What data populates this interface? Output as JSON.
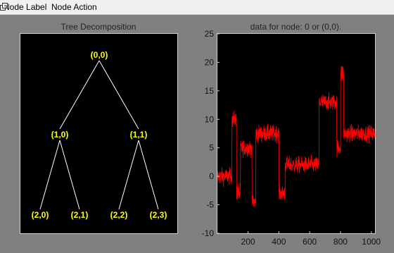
{
  "menu": {
    "items": [
      "Node Label",
      "Node Action"
    ]
  },
  "window_controls": {
    "undock_icon": "undock-icon"
  },
  "tree_panel": {
    "title": "Tree Decomposition",
    "nodes": [
      {
        "id": "0-0",
        "label": "(0,0)"
      },
      {
        "id": "1-0",
        "label": "(1,0)"
      },
      {
        "id": "1-1",
        "label": "(1,1)"
      },
      {
        "id": "2-0",
        "label": "(2,0)"
      },
      {
        "id": "2-1",
        "label": "(2,1)"
      },
      {
        "id": "2-2",
        "label": "(2,2)"
      },
      {
        "id": "2-3",
        "label": "(2,3)"
      }
    ],
    "edges": [
      [
        "0-0",
        "1-0"
      ],
      [
        "0-0",
        "1-1"
      ],
      [
        "1-0",
        "2-0"
      ],
      [
        "1-0",
        "2-1"
      ],
      [
        "1-1",
        "2-2"
      ],
      [
        "1-1",
        "2-3"
      ]
    ],
    "edge_color": "#ffffff",
    "label_color": "#ffff00",
    "background": "#000000"
  },
  "colors": {
    "figure_background": "#808080",
    "signal": "#ff0000",
    "axes_background": "#000000"
  },
  "chart_data": {
    "type": "line",
    "title": "data for node: 0 or (0,0).",
    "xlabel": "",
    "ylabel": "",
    "xlim": [
      1,
      1024
    ],
    "ylim": [
      -10,
      25
    ],
    "xticks": [
      200,
      400,
      600,
      800,
      1000
    ],
    "yticks": [
      -10,
      -5,
      0,
      5,
      10,
      15,
      20,
      25
    ],
    "grid": false,
    "series": [
      {
        "color": "#ff0000",
        "segments": [
          {
            "x_start": 1,
            "x_end": 95,
            "level": 0,
            "noise": 1.2
          },
          {
            "x_start": 96,
            "x_end": 125,
            "level": 10,
            "noise": 1.2
          },
          {
            "x_start": 126,
            "x_end": 150,
            "level": -3,
            "noise": 1.5
          },
          {
            "x_start": 151,
            "x_end": 225,
            "level": 5,
            "noise": 1.2
          },
          {
            "x_start": 226,
            "x_end": 250,
            "level": -4.5,
            "noise": 1.2
          },
          {
            "x_start": 251,
            "x_end": 400,
            "level": 7.5,
            "noise": 1.2
          },
          {
            "x_start": 401,
            "x_end": 440,
            "level": -3,
            "noise": 1.2
          },
          {
            "x_start": 441,
            "x_end": 660,
            "level": 2,
            "noise": 1.2
          },
          {
            "x_start": 661,
            "x_end": 775,
            "level": 13,
            "noise": 1.2
          },
          {
            "x_start": 776,
            "x_end": 800,
            "level": 5,
            "noise": 1.2
          },
          {
            "x_start": 801,
            "x_end": 820,
            "level": 18,
            "noise": 1.5
          },
          {
            "x_start": 821,
            "x_end": 1024,
            "level": 7.5,
            "noise": 1.2
          }
        ]
      }
    ]
  }
}
